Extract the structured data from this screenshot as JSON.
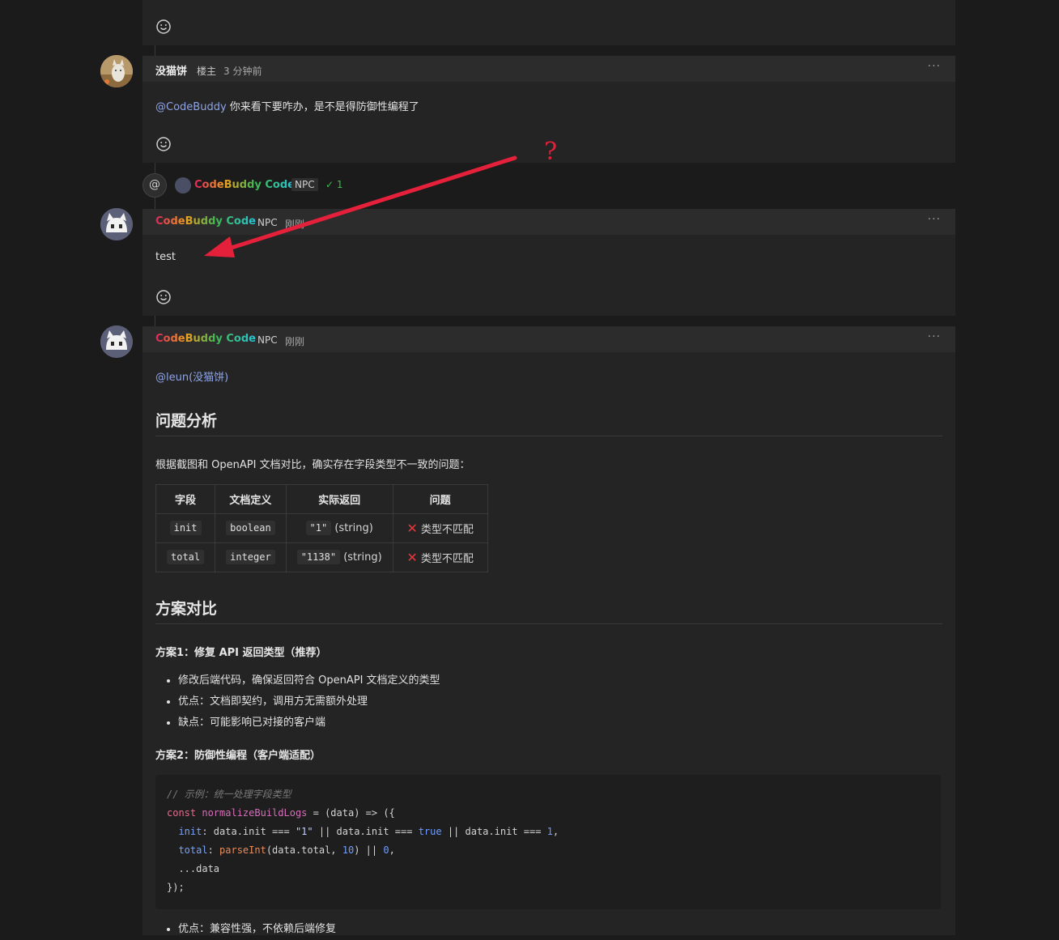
{
  "comment_op": {
    "author": "没猫饼",
    "role": "楼主",
    "time": "3 分钟前",
    "mention": "@CodeBuddy",
    "text": " 你来看下要咋办，是不是得防御性编程了"
  },
  "reply_summary": {
    "name": "CodeBuddy Code",
    "badge": "NPC",
    "check_count": "✓ 1"
  },
  "comment_test": {
    "author": "CodeBuddy Code",
    "badge": "NPC",
    "time": "刚刚",
    "text": "test"
  },
  "annotation": {
    "mark": "?",
    "color": "#e5203a"
  },
  "comment_answer": {
    "author": "CodeBuddy Code",
    "badge": "NPC",
    "time": "刚刚",
    "mention": "@leun(没猫饼)",
    "h_analysis": "问题分析",
    "intro": "根据截图和 OpenAPI 文档对比，确实存在字段类型不一致的问题：",
    "table": {
      "headers": [
        "字段",
        "文档定义",
        "实际返回",
        "问题"
      ],
      "rows": [
        {
          "field": "init",
          "doc": "boolean",
          "actual_code": "\"1\"",
          "actual_type": " (string)",
          "issue": "类型不匹配"
        },
        {
          "field": "total",
          "doc": "integer",
          "actual_code": "\"1138\"",
          "actual_type": " (string)",
          "issue": "类型不匹配"
        }
      ]
    },
    "h_compare": "方案对比",
    "plan1_title": "方案1：修复 API 返回类型（推荐）",
    "plan1_points": [
      "修改后端代码，确保返回符合 OpenAPI 文档定义的类型",
      "优点：文档即契约，调用方无需额外处理",
      "缺点：可能影响已对接的客户端"
    ],
    "plan2_title": "方案2：防御性编程（客户端适配）",
    "code": {
      "comment": "// 示例：统一处理字段类型",
      "l2_const": "const ",
      "l2_fn": "normalizeBuildLogs",
      "l2_rest": " = (data) => ({",
      "l3_prop": "init",
      "l3_a": ": data.init === ",
      "l3_str": "\"1\"",
      "l3_b": " || data.init === ",
      "l3_bool": "true",
      "l3_c": " || data.init === ",
      "l3_num": "1",
      "l3_d": ",",
      "l4_prop": "total",
      "l4_a": ": ",
      "l4_call": "parseInt",
      "l4_b": "(data.total, ",
      "l4_num1": "10",
      "l4_c": ") || ",
      "l4_num2": "0",
      "l4_d": ",",
      "l5": "...data",
      "l6": "});"
    },
    "plan2_point_partial": "优点：兼容性强，不依赖后端修复"
  },
  "icons": [
    "smile-icon",
    "more-icon",
    "at-icon",
    "check-icon",
    "cross-icon"
  ]
}
